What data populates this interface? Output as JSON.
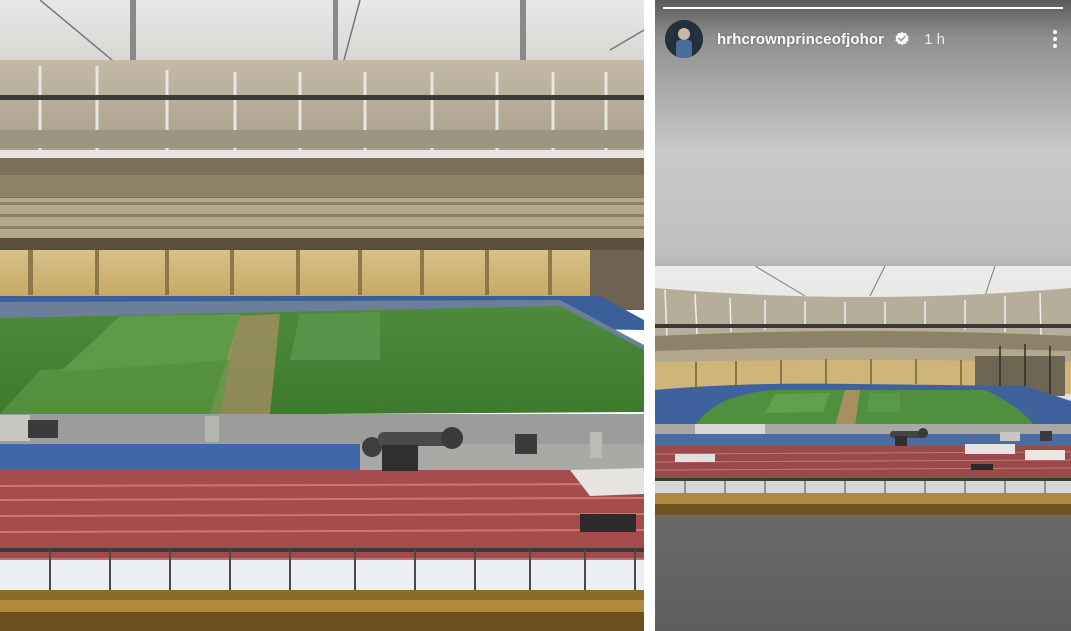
{
  "story": {
    "username": "hrhcrownprinceofjohor",
    "time_ago": "1 h",
    "progress": 1.0,
    "verified": true,
    "icons": {
      "avatar": "profile-avatar",
      "verified": "verified-badge-icon",
      "more": "more-options-icon"
    }
  },
  "images": {
    "left": "stadium-photo-close-view",
    "right": "stadium-photo-wide-view"
  }
}
